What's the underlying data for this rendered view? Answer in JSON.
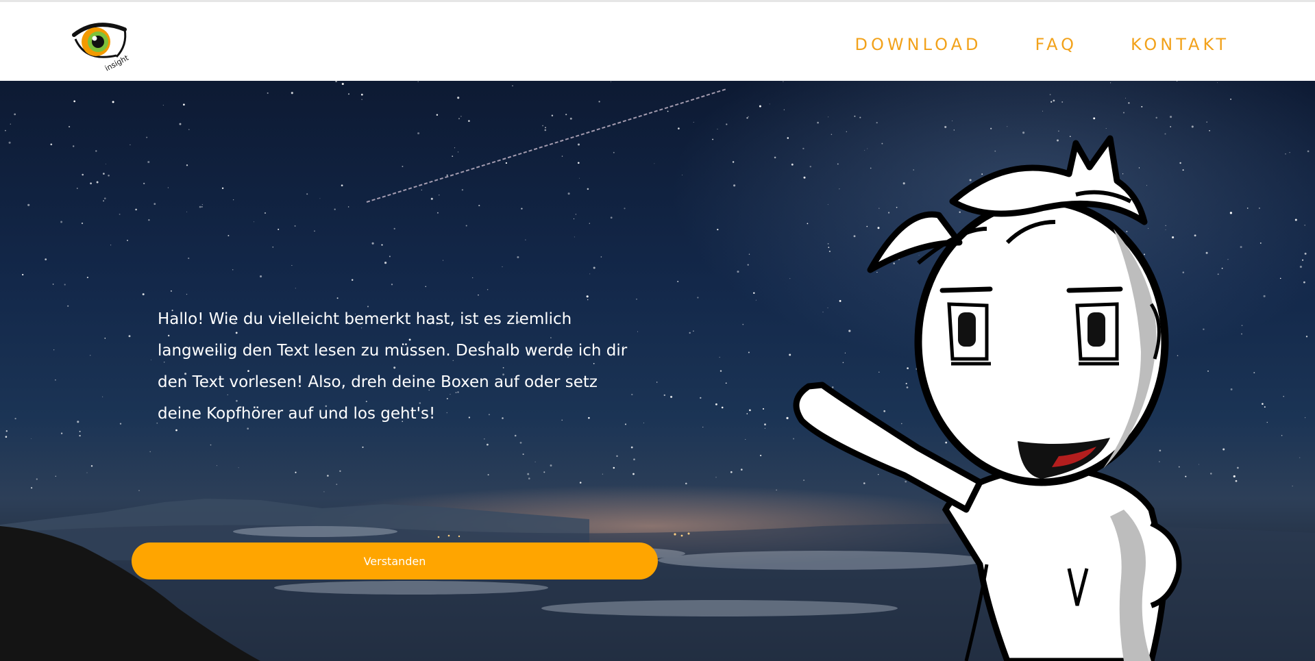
{
  "header": {
    "logo_text": "insight",
    "nav": [
      "DOWNLOAD",
      "FAQ",
      "KONTAKT"
    ]
  },
  "hero": {
    "intro_text": "Hallo! Wie du vielleicht bemerkt hast, ist es ziemlich langweilig den Text lesen zu müssen. Deshalb werde ich dir den Text vorlesen! Also, dreh deine Boxen auf oder setz deine Kopfhörer auf und los geht's!",
    "button_label": "Verstanden"
  },
  "colors": {
    "accent": "#ffa500",
    "nav_text": "#f2a21b",
    "sky_dark": "#0d1a33",
    "mouth_red": "#b41e1e"
  },
  "icons": [
    "eye-logo-icon"
  ]
}
